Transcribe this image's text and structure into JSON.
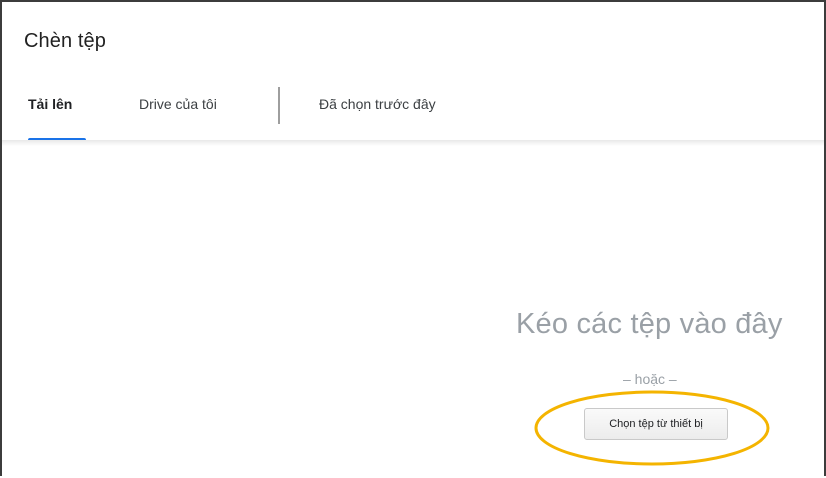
{
  "dialog": {
    "title": "Chèn tệp"
  },
  "tabs": [
    {
      "label": "Tải lên",
      "active": true
    },
    {
      "label": "Drive của tôi",
      "active": false
    },
    {
      "label": "Đã chọn trước đây",
      "active": false
    }
  ],
  "drop_zone": {
    "heading": "Kéo các tệp vào đây",
    "or_text": "– hoặc –",
    "choose_button_label": "Chọn tệp từ thiết bị"
  },
  "colors": {
    "accent": "#1a73e8",
    "highlight": "#f4b400",
    "muted_text": "#9aa0a6"
  }
}
